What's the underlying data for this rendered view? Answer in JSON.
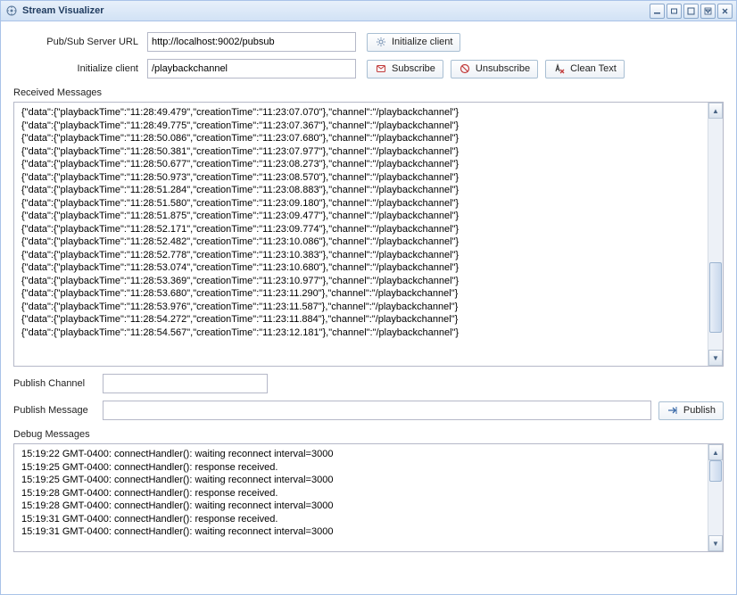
{
  "window": {
    "title": "Stream Visualizer"
  },
  "form": {
    "server_url_label": "Pub/Sub Server URL",
    "server_url_value": "http://localhost:9002/pubsub",
    "init_client_label": "Initialize client",
    "channel_value": "/playbackchannel",
    "initialize_btn": "Initialize client",
    "subscribe_btn": "Subscribe",
    "unsubscribe_btn": "Unsubscribe",
    "clean_text_btn": "Clean Text"
  },
  "received_label": "Received Messages",
  "received_messages": [
    "{\"data\":{\"playbackTime\":\"11:28:49.479\",\"creationTime\":\"11:23:07.070\"},\"channel\":\"/playbackchannel\"}",
    "{\"data\":{\"playbackTime\":\"11:28:49.775\",\"creationTime\":\"11:23:07.367\"},\"channel\":\"/playbackchannel\"}",
    "{\"data\":{\"playbackTime\":\"11:28:50.086\",\"creationTime\":\"11:23:07.680\"},\"channel\":\"/playbackchannel\"}",
    "{\"data\":{\"playbackTime\":\"11:28:50.381\",\"creationTime\":\"11:23:07.977\"},\"channel\":\"/playbackchannel\"}",
    "{\"data\":{\"playbackTime\":\"11:28:50.677\",\"creationTime\":\"11:23:08.273\"},\"channel\":\"/playbackchannel\"}",
    "{\"data\":{\"playbackTime\":\"11:28:50.973\",\"creationTime\":\"11:23:08.570\"},\"channel\":\"/playbackchannel\"}",
    "{\"data\":{\"playbackTime\":\"11:28:51.284\",\"creationTime\":\"11:23:08.883\"},\"channel\":\"/playbackchannel\"}",
    "{\"data\":{\"playbackTime\":\"11:28:51.580\",\"creationTime\":\"11:23:09.180\"},\"channel\":\"/playbackchannel\"}",
    "{\"data\":{\"playbackTime\":\"11:28:51.875\",\"creationTime\":\"11:23:09.477\"},\"channel\":\"/playbackchannel\"}",
    "{\"data\":{\"playbackTime\":\"11:28:52.171\",\"creationTime\":\"11:23:09.774\"},\"channel\":\"/playbackchannel\"}",
    "{\"data\":{\"playbackTime\":\"11:28:52.482\",\"creationTime\":\"11:23:10.086\"},\"channel\":\"/playbackchannel\"}",
    "{\"data\":{\"playbackTime\":\"11:28:52.778\",\"creationTime\":\"11:23:10.383\"},\"channel\":\"/playbackchannel\"}",
    "{\"data\":{\"playbackTime\":\"11:28:53.074\",\"creationTime\":\"11:23:10.680\"},\"channel\":\"/playbackchannel\"}",
    "{\"data\":{\"playbackTime\":\"11:28:53.369\",\"creationTime\":\"11:23:10.977\"},\"channel\":\"/playbackchannel\"}",
    "{\"data\":{\"playbackTime\":\"11:28:53.680\",\"creationTime\":\"11:23:11.290\"},\"channel\":\"/playbackchannel\"}",
    "{\"data\":{\"playbackTime\":\"11:28:53.976\",\"creationTime\":\"11:23:11.587\"},\"channel\":\"/playbackchannel\"}",
    "{\"data\":{\"playbackTime\":\"11:28:54.272\",\"creationTime\":\"11:23:11.884\"},\"channel\":\"/playbackchannel\"}",
    "{\"data\":{\"playbackTime\":\"11:28:54.567\",\"creationTime\":\"11:23:12.181\"},\"channel\":\"/playbackchannel\"}"
  ],
  "publish": {
    "channel_label": "Publish Channel",
    "channel_value": "",
    "message_label": "Publish Message",
    "message_value": "",
    "publish_btn": "Publish"
  },
  "debug_label": "Debug Messages",
  "debug_messages": [
    "15:19:22 GMT-0400: connectHandler(): waiting reconnect interval=3000",
    "15:19:25 GMT-0400: connectHandler(): response received.",
    "15:19:25 GMT-0400: connectHandler(): waiting reconnect interval=3000",
    "15:19:28 GMT-0400: connectHandler(): response received.",
    "15:19:28 GMT-0400: connectHandler(): waiting reconnect interval=3000",
    "15:19:31 GMT-0400: connectHandler(): response received.",
    "15:19:31 GMT-0400: connectHandler(): waiting reconnect interval=3000"
  ]
}
